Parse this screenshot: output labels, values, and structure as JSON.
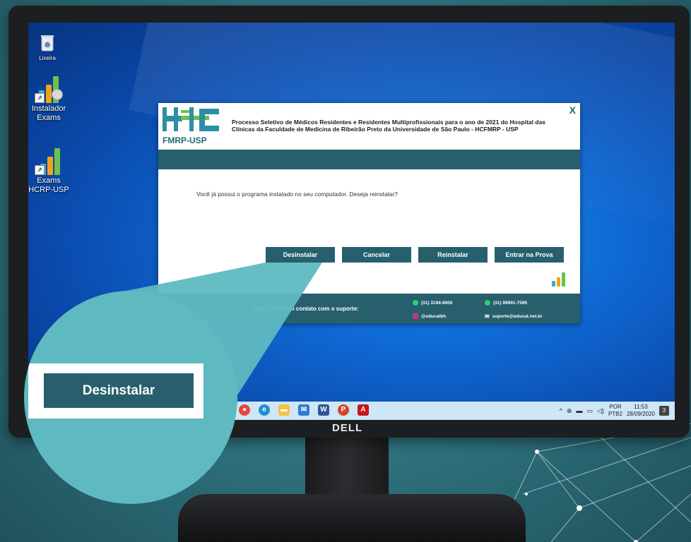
{
  "desktop": {
    "icons": [
      {
        "label": "Lixeira",
        "icon": "recycle-bin-icon"
      },
      {
        "label": "Instalador\nExams",
        "icon": "installer-icon"
      },
      {
        "label": "Exams\nHCRP-USP",
        "icon": "exams-icon"
      }
    ]
  },
  "dialog": {
    "logo_text": "FMRP-USP",
    "title": "Processo Seletivo de Médicos Residentes e Residentes Multiprofissionais para o ano de 2021 do Hospital das Clínicas da Faculdade de Medicina de Ribeirão Preto da Universidade de São Paulo - HCFMRP - USP",
    "close_label": "X",
    "message": "Você já possui o programa instalado no seu computador. Deseja reinstalar?",
    "buttons": {
      "uninstall": "Desinstalar",
      "cancel": "Cancelar",
      "reinstall": "Reinstalar",
      "enter": "Entrar na Prova"
    },
    "footer": {
      "text": "idade, entre em contato com o suporte:",
      "phone1": "(31) 3194-8900",
      "phone2": "(31) 99991-7595",
      "instagram": "@educatbh",
      "email": "suporte@educat.net.br"
    }
  },
  "zoom": {
    "label": "Desinstalar"
  },
  "taskbar": {
    "lang": "POR",
    "layout": "PTB2",
    "time": "11:53",
    "date": "28/09/2020",
    "notifications": "3"
  },
  "monitor": {
    "brand": "DELL"
  },
  "colors": {
    "primary": "#275f6d",
    "accent_teal": "#5fb9c1",
    "desktop_blue": "#0f68d2"
  }
}
